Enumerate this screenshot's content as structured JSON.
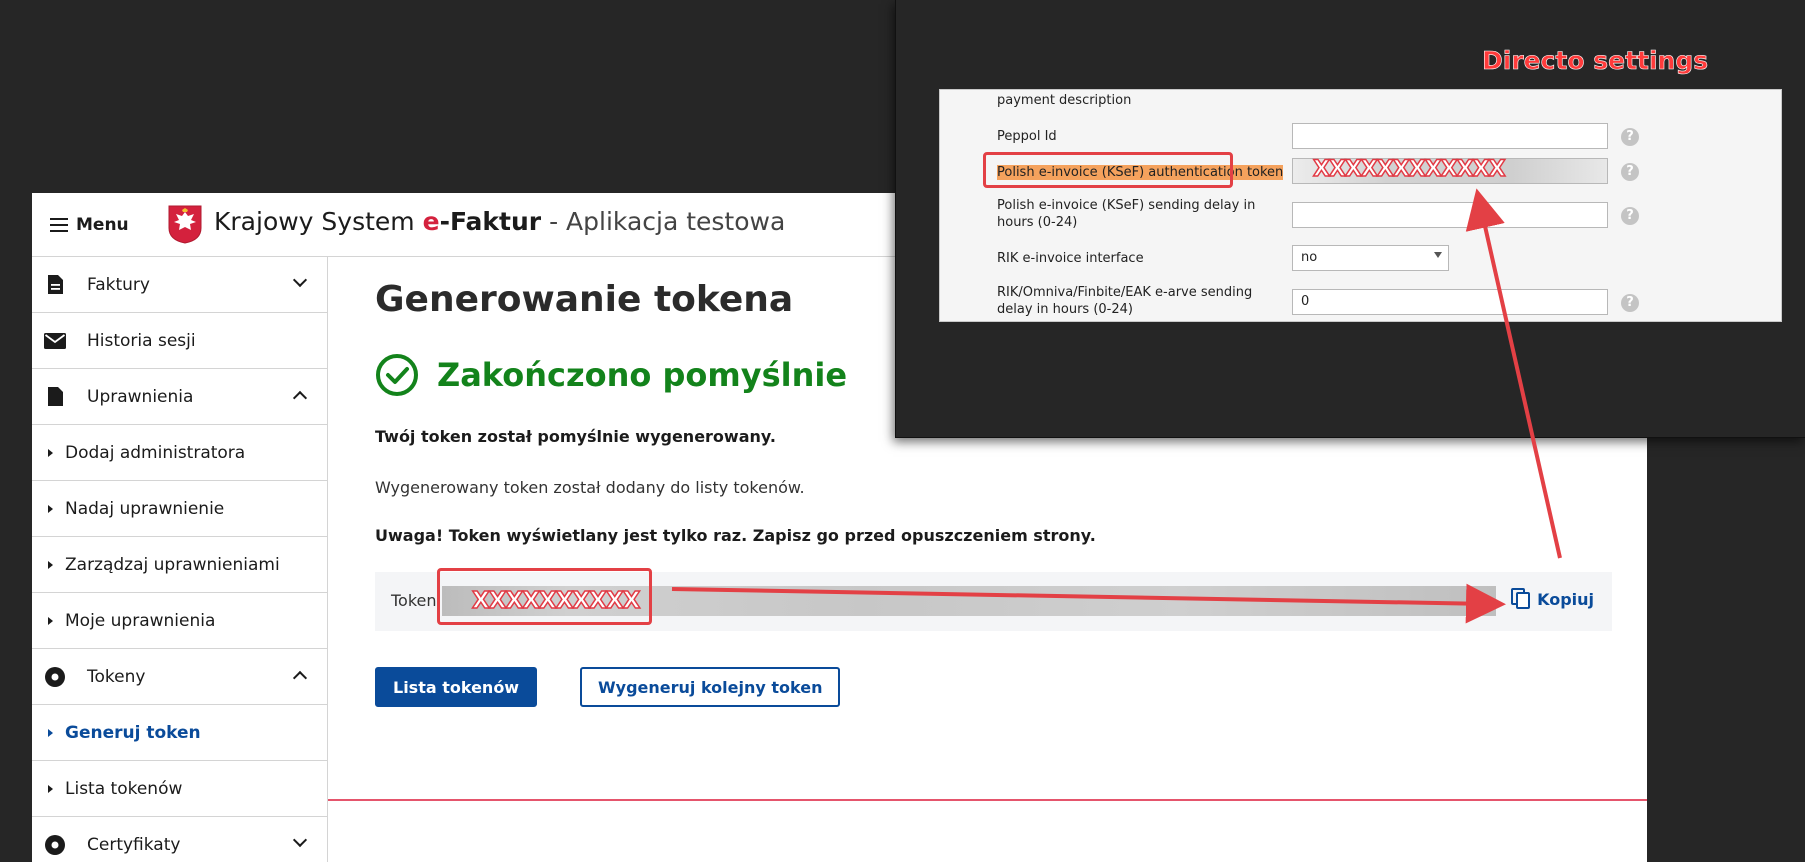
{
  "app": {
    "menu_label": "Menu",
    "brand_part1": "Krajowy System ",
    "brand_e": "e",
    "brand_faktur": "-Faktur",
    "brand_rest": " - Aplikacja testowa"
  },
  "sidebar": {
    "items": [
      {
        "label": "Faktury"
      },
      {
        "label": "Historia sesji"
      },
      {
        "label": "Uprawnienia"
      },
      {
        "label": "Dodaj administratora"
      },
      {
        "label": "Nadaj uprawnienie"
      },
      {
        "label": "Zarządzaj uprawnieniami"
      },
      {
        "label": "Moje uprawnienia"
      },
      {
        "label": "Tokeny"
      },
      {
        "label": "Generuj token"
      },
      {
        "label": "Lista tokenów"
      },
      {
        "label": "Certyfikaty"
      }
    ]
  },
  "main": {
    "title": "Generowanie tokena",
    "success": "Zakończono pomyślnie",
    "msg1": "Twój token został pomyślnie wygenerowany.",
    "msg2": "Wygenerowany token został dodany do listy tokenów.",
    "msg3": "Uwaga! Token wyświetlany jest tylko raz. Zapisz go przed opuszczeniem strony.",
    "token_label": "Token",
    "token_mask": "XXXXXXXXXX",
    "copy_label": "Kopiuj",
    "btn_list": "Lista tokenów",
    "btn_generate": "Wygeneruj kolejny token"
  },
  "directo": {
    "title": "Directo settings",
    "rows": {
      "payment_desc": "payment description",
      "peppol": "Peppol Id",
      "ksef_token": "Polish e-invoice (KSeF) authentication token",
      "ksef_token_mask": "XXXXXXXXXXXX",
      "ksef_delay": "Polish e-invoice (KSeF) sending delay in hours (0-24)",
      "rik_interface": "RIK e-invoice interface",
      "rik_interface_value": "no",
      "rik_delay": "RIK/Omniva/Finbite/EAK e-arve sending delay in hours (0-24)",
      "rik_delay_value": "0",
      "help": "?"
    }
  },
  "colors": {
    "primary": "#0a4b9a",
    "success": "#13831b",
    "annotation": "#e34045"
  }
}
